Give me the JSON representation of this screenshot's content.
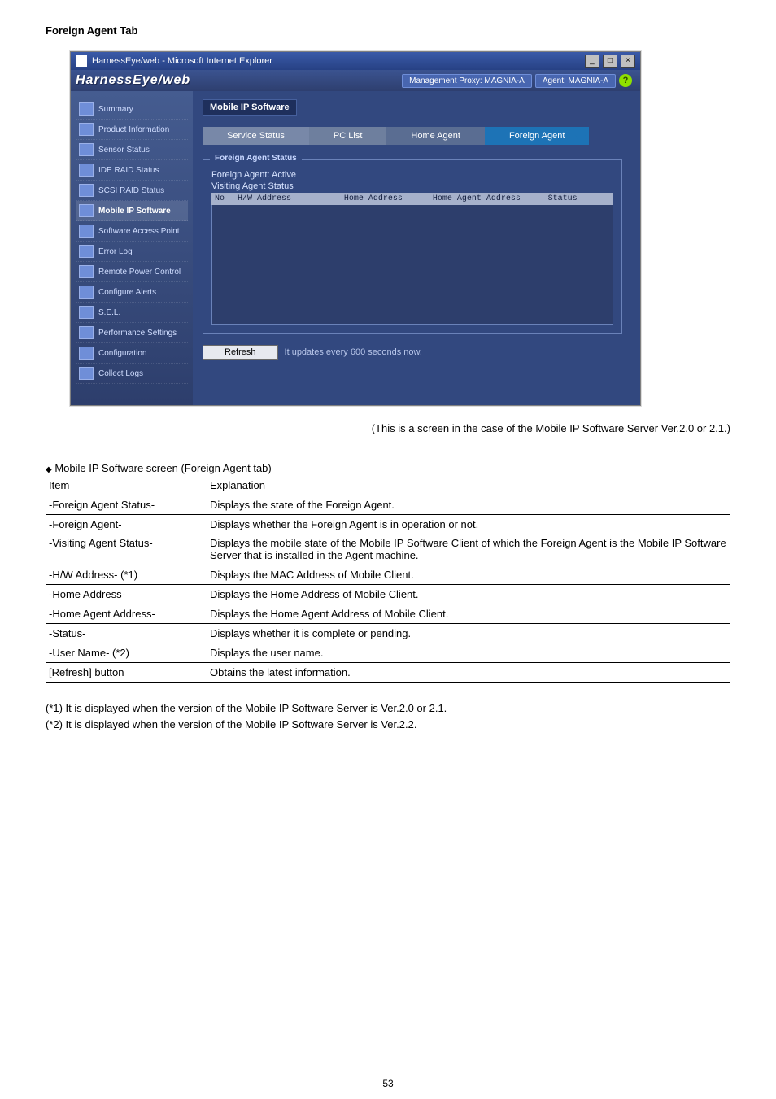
{
  "heading": "Foreign Agent Tab",
  "ie_window_title": "HarnessEye/web - Microsoft Internet Explorer",
  "brand_name": "HarnessEye/web",
  "badges": {
    "mgmt_proxy": "Management Proxy: MAGNIA-A",
    "agent": "Agent: MAGNIA-A"
  },
  "sidebar": [
    {
      "label": "Summary"
    },
    {
      "label": "Product Information"
    },
    {
      "label": "Sensor Status"
    },
    {
      "label": "IDE RAID Status"
    },
    {
      "label": "SCSI RAID Status"
    },
    {
      "label": "Mobile IP Software",
      "selected": true
    },
    {
      "label": "Software Access Point"
    },
    {
      "label": "Error Log"
    },
    {
      "label": "Remote Power Control"
    },
    {
      "label": "Configure Alerts"
    },
    {
      "label": "S.E.L."
    },
    {
      "label": "Performance Settings"
    },
    {
      "label": "Configuration"
    },
    {
      "label": "Collect Logs"
    }
  ],
  "panel_title": "Mobile IP Software",
  "tabs": {
    "service_status": "Service Status",
    "pc_list": "PC List",
    "home_agent": "Home Agent",
    "foreign_agent": "Foreign Agent"
  },
  "group_title": "Foreign Agent Status",
  "kv": {
    "fa": {
      "k": "Foreign Agent:",
      "v": "Active"
    },
    "va": "Visiting Agent Status"
  },
  "table_headers": {
    "no": "No",
    "hw": "H/W Address",
    "home_addr": "Home Address",
    "home_agent_addr": "Home Agent Address",
    "status": "Status"
  },
  "refresh_label": "Refresh",
  "refresh_note": "It updates every 600 seconds now.",
  "caption": "(This is a screen in the case of the Mobile IP Software Server Ver.2.0 or 2.1.)",
  "table_title": "Mobile IP Software screen (Foreign Agent tab)",
  "table_columns": {
    "item": "Item",
    "explanation": "Explanation"
  },
  "rows": [
    {
      "item": "-Foreign Agent Status-",
      "expl": "Displays the state of the Foreign Agent.",
      "sep": true
    },
    {
      "item": "-Foreign Agent-",
      "expl": "Displays whether the Foreign Agent is in operation or not.",
      "sep": false
    },
    {
      "item": "-Visiting Agent Status-",
      "expl": "Displays the mobile state of the Mobile IP Software Client of which the Foreign Agent is the Mobile IP Software Server that is installed in the Agent machine.",
      "sep": true
    },
    {
      "item": "-H/W Address- (*1)",
      "expl": "Displays the MAC Address of Mobile Client.",
      "sep": false
    },
    {
      "item": "-Home Address-",
      "expl": "Displays the Home Address of Mobile Client.",
      "sep": true,
      "sep_top": true
    },
    {
      "item": "-Home Agent Address-",
      "expl": "Displays the Home Agent Address of Mobile Client.",
      "sep": true
    },
    {
      "item": "-Status-",
      "expl": "Displays whether it is complete or pending.",
      "sep": false
    },
    {
      "item": "-User Name- (*2)",
      "expl": "Displays the user name.",
      "sep": true,
      "sep_top": true
    },
    {
      "item": "[Refresh] button",
      "expl": "Obtains the latest information.",
      "sep": true
    }
  ],
  "notes": {
    "n1": "(*1) It is displayed when the version of the Mobile IP Software Server is Ver.2.0 or 2.1.",
    "n2": "(*2) It is displayed when the version of the Mobile IP Software Server is Ver.2.2."
  },
  "page_num": "53"
}
